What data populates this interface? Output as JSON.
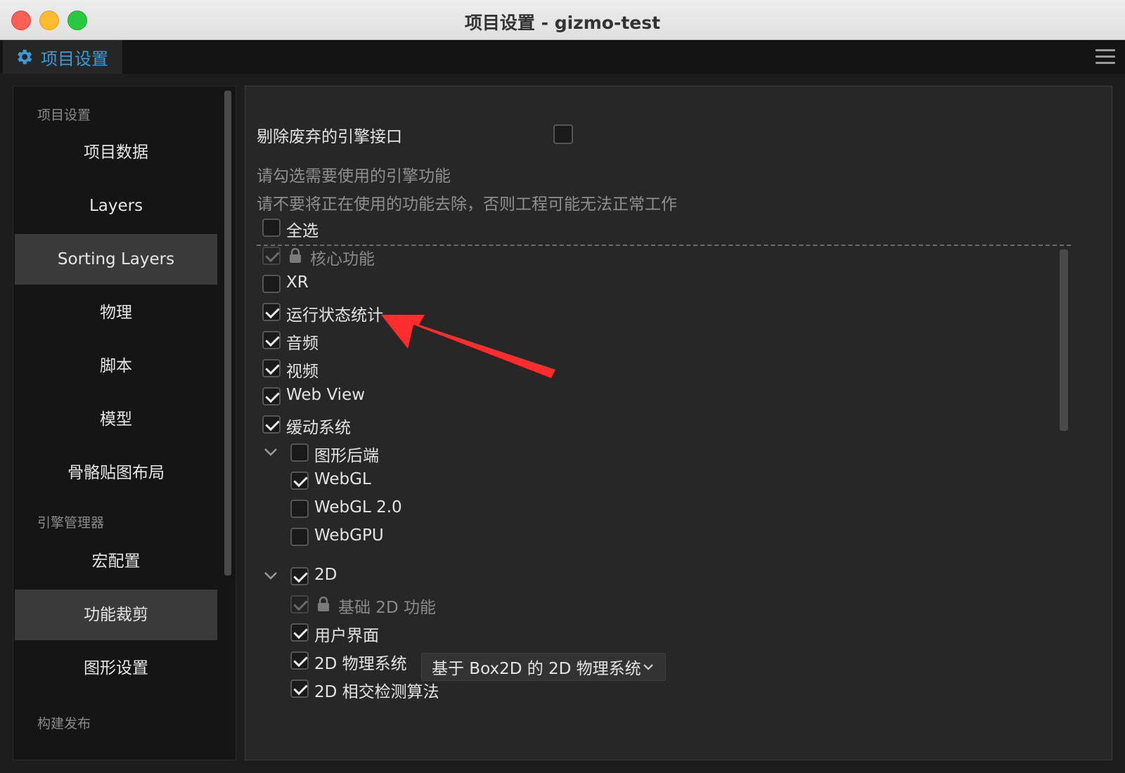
{
  "window": {
    "title": "项目设置 - gizmo-test"
  },
  "tab": {
    "label": "项目设置",
    "icon": "gear-icon"
  },
  "colors": {
    "accent": "#3d9ad8",
    "annotation": "#ff2d2d"
  },
  "sidebar": {
    "section_project": "项目设置",
    "items_project": [
      "项目数据",
      "Layers",
      "Sorting Layers",
      "物理",
      "脚本",
      "模型",
      "骨骼贴图布局"
    ],
    "section_engine": "引擎管理器",
    "items_engine": [
      "宏配置",
      "功能裁剪",
      "图形设置"
    ],
    "section_build": "构建发布",
    "selected": [
      "Sorting Layers",
      "功能裁剪"
    ]
  },
  "main": {
    "remove_deprecated_label": "剔除废弃的引擎接口",
    "remove_deprecated_checked": false,
    "hint1": "请勾选需要使用的引擎功能",
    "hint2": "请不要将正在使用的功能去除，否则工程可能无法正常工作",
    "select_all": "全选",
    "features": {
      "core": "核心功能",
      "xr": "XR",
      "profiler": "运行状态统计",
      "audio": "音频",
      "video": "视频",
      "webview": "Web View",
      "tween": "缓动系统",
      "gfx_backend": "图形后端",
      "webgl": "WebGL",
      "webgl2": "WebGL 2.0",
      "webgpu": "WebGPU",
      "twod": "2D",
      "twod_base": "基础 2D 功能",
      "ui": "用户界面",
      "physics2d": "2D 物理系统",
      "physics2d_option": "基于 Box2D 的 2D 物理系统",
      "intersection2d": "2D 相交检测算法"
    }
  }
}
